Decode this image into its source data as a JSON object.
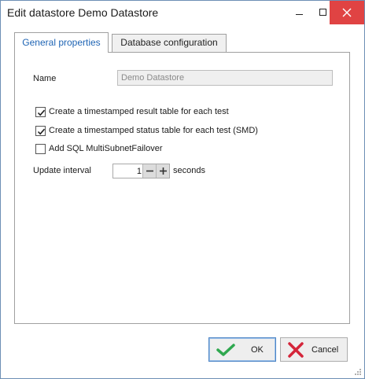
{
  "window": {
    "title": "Edit datastore Demo Datastore"
  },
  "tabs": [
    {
      "label": "General properties",
      "active": true
    },
    {
      "label": "Database configuration",
      "active": false
    }
  ],
  "general": {
    "name_label": "Name",
    "name_value": "Demo Datastore",
    "checkboxes": [
      {
        "label": "Create a timestamped result table for each test",
        "checked": true
      },
      {
        "label": "Create a timestamped status table for each test (SMD)",
        "checked": true
      },
      {
        "label": "Add SQL MultiSubnetFailover",
        "checked": false
      }
    ],
    "update_interval_label": "Update interval",
    "update_interval_value": "1",
    "update_interval_unit": "seconds"
  },
  "buttons": {
    "ok": "OK",
    "cancel": "Cancel"
  },
  "colors": {
    "accent": "#1e64b4",
    "close_button": "#e04343",
    "ok_check": "#2fa84f",
    "cancel_x": "#d4253a"
  },
  "icons": [
    "minimize-icon",
    "maximize-icon",
    "close-icon",
    "checkmark-icon",
    "cancel-x-icon",
    "spin-minus-icon",
    "spin-plus-icon",
    "resize-grip-icon"
  ]
}
